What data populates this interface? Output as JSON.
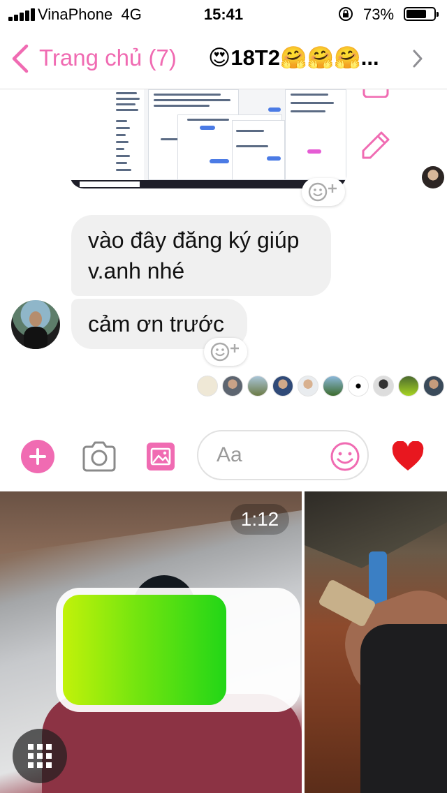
{
  "status_bar": {
    "carrier": "VinaPhone",
    "network": "4G",
    "time": "15:41",
    "battery_percent": "73%",
    "battery_level": 0.73
  },
  "nav": {
    "back_label": "Trang chủ (7)",
    "group_prefix_emoji": "😍",
    "group_name": "18T2",
    "group_suffix_emoji": "🤗🤗🤗",
    "group_ellipsis": "..."
  },
  "messages": [
    {
      "text_line1": "vào đây đăng ký giúp",
      "text_line2": "v.anh nhé"
    },
    {
      "text": "cảm ơn trước"
    }
  ],
  "icons": {
    "react": "smiley-plus-icon",
    "edit": "pencil-icon",
    "add": "plus-icon",
    "camera": "camera-icon",
    "gallery": "image-icon",
    "emoji": "smiley-icon",
    "like": "heart-icon",
    "grid": "grid-icon"
  },
  "composer": {
    "placeholder": "Aa"
  },
  "media": {
    "video_duration": "1:12",
    "overlay_battery_level": 0.71
  },
  "colors": {
    "accent": "#f06bb2",
    "bubble": "#f0f0f0",
    "heart": "#e8171f"
  }
}
